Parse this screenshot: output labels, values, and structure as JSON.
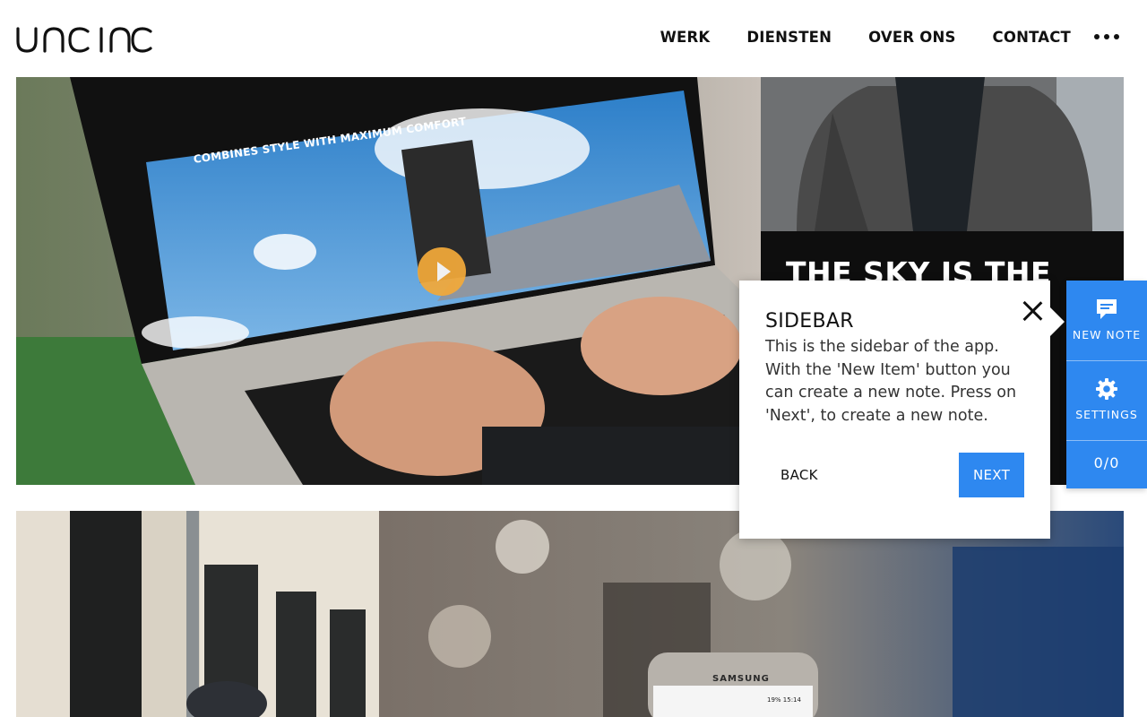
{
  "header": {
    "logo_text": "unc inc",
    "nav": [
      "WERK",
      "DIENSTEN",
      "OVER ONS",
      "CONTACT"
    ],
    "more_icon": "more-horizontal-icon"
  },
  "tiles": {
    "laptop": {
      "promo_text": "COMBINES STYLE WITH MAXIMUM COMFORT",
      "play_icon": "play-icon"
    },
    "jacket": {
      "headline": "THE SKY IS THE"
    },
    "phone": {
      "brand": "SAMSUNG",
      "status_time": "19% 15:14"
    }
  },
  "popover": {
    "title": "SIDEBAR",
    "body": "This is the sidebar of the app. With the 'New Item' button you can create a new note. Press on 'Next', to create a new note.",
    "back_label": "BACK",
    "next_label": "NEXT",
    "close_icon": "close-icon"
  },
  "sidebar": {
    "new_note_label": "NEW NOTE",
    "new_note_icon": "note-icon",
    "settings_label": "SETTINGS",
    "settings_icon": "gear-icon",
    "count": "0/0"
  },
  "colors": {
    "accent": "#2e88f0",
    "play_button": "#f2a93a",
    "text": "#111111"
  }
}
